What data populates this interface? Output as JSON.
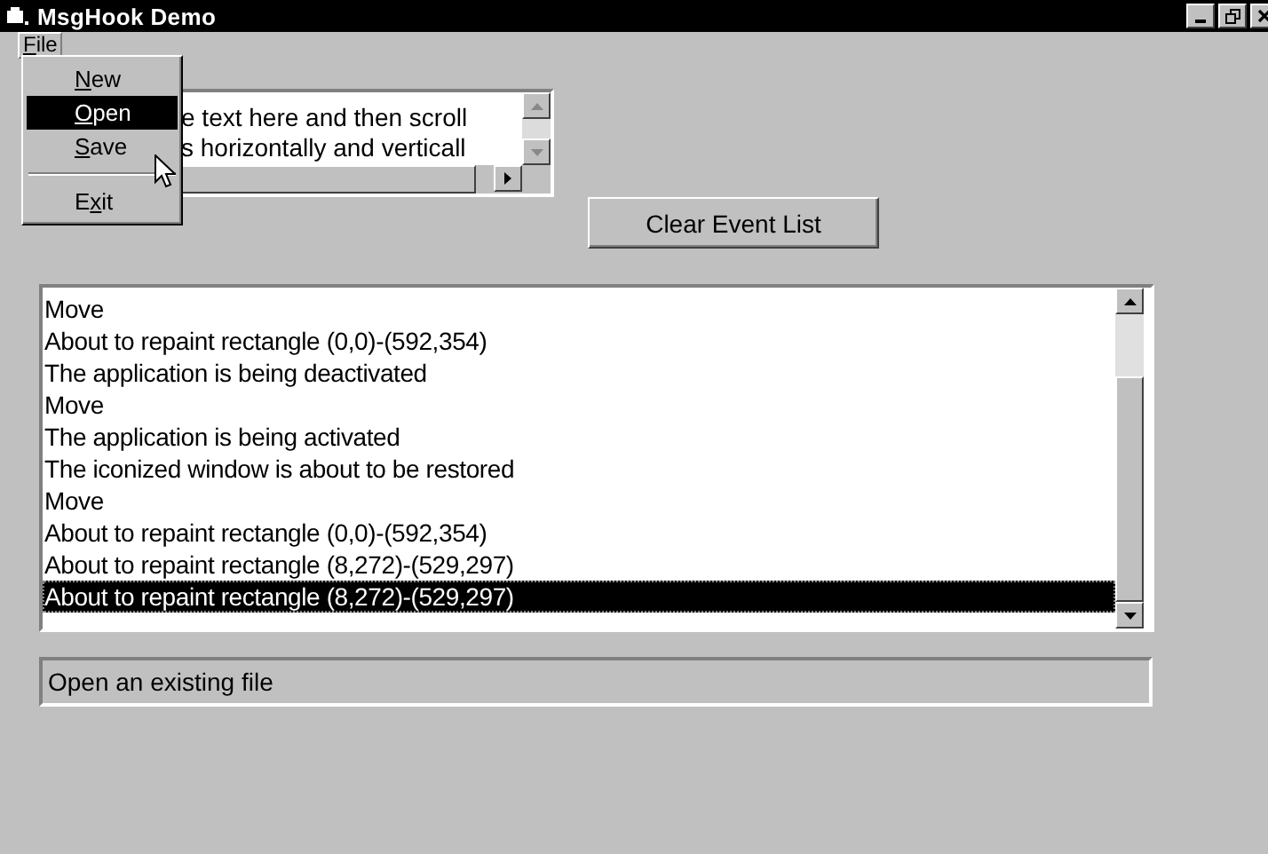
{
  "window": {
    "title": "MsgHook Demo"
  },
  "menu_bar": [
    {
      "key": "F",
      "after": "ile",
      "selected": true
    }
  ],
  "file_menu": [
    {
      "kind": "item",
      "key": "N",
      "after": "ew",
      "selected": false
    },
    {
      "kind": "item",
      "key": "O",
      "after": "pen",
      "selected": true
    },
    {
      "kind": "item",
      "key": "S",
      "after": "ave",
      "selected": false
    },
    {
      "kind": "separator"
    },
    {
      "kind": "item",
      "before": "E",
      "key": "x",
      "after": "it",
      "selected": false
    }
  ],
  "text_box": {
    "lines": [
      "e text here and then scroll",
      "s horizontally and verticall"
    ]
  },
  "clear_button": "Clear Event List",
  "event_list": [
    {
      "text": "Move",
      "selected": false
    },
    {
      "text": "About to repaint rectangle (0,0)-(592,354)",
      "selected": false
    },
    {
      "text": "The application is being deactivated",
      "selected": false
    },
    {
      "text": "Move",
      "selected": false
    },
    {
      "text": "The application is being activated",
      "selected": false
    },
    {
      "text": "The iconized window is about to be restored",
      "selected": false
    },
    {
      "text": "Move",
      "selected": false
    },
    {
      "text": "About to repaint rectangle (0,0)-(592,354)",
      "selected": false
    },
    {
      "text": "About to repaint rectangle (8,272)-(529,297)",
      "selected": false
    },
    {
      "text": "About to repaint rectangle (8,272)-(529,297)",
      "selected": true
    }
  ],
  "status": "Open an existing file"
}
